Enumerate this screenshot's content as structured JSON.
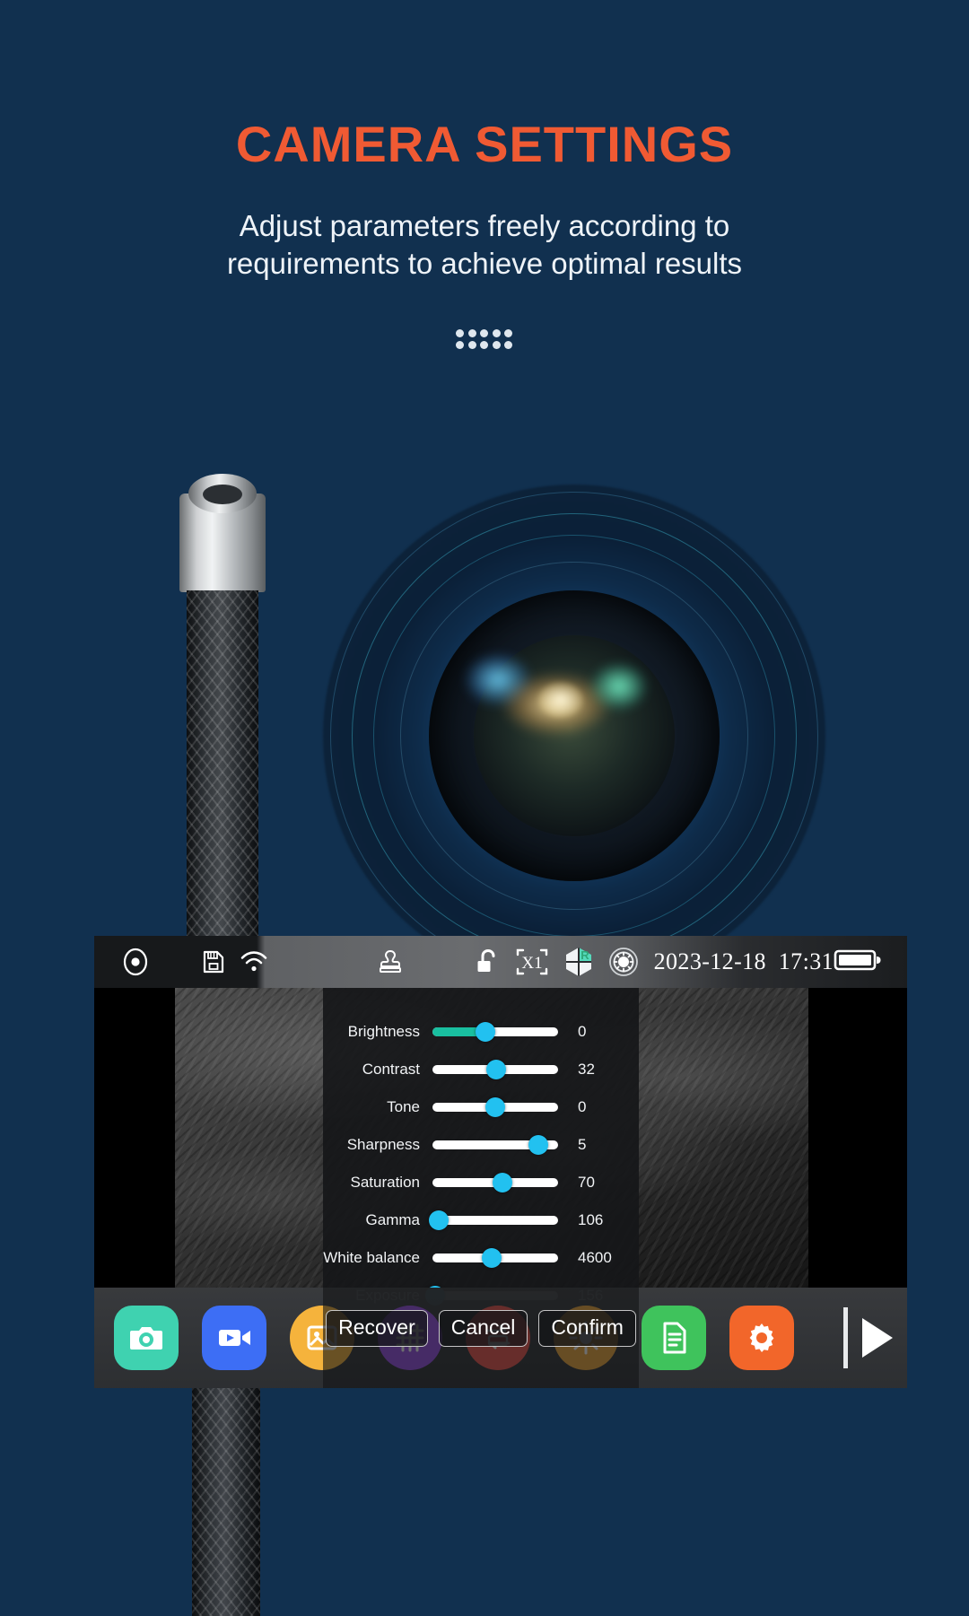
{
  "header": {
    "title": "CAMERA SETTINGS",
    "subtitle_line1": "Adjust parameters freely according to",
    "subtitle_line2": "requirements to achieve optimal results",
    "title_color": "#f05a33",
    "background_color": "#11304f",
    "dots_count": 10
  },
  "device": {
    "statusbar": {
      "record_icon": "record-dot-icon",
      "sd_card_icon": "sd-card-icon",
      "wifi_icon": "wifi-icon",
      "stamp_icon": "stamp-icon",
      "lock_icon": "unlock-padlock-icon",
      "zoom_label": "X1",
      "rotate_icon": "rotate-hexagon-icon",
      "rotate_badge": "R",
      "rotate_badge_color": "#4fe0a8",
      "led_icon": "led-lamp-icon",
      "date": "2023-12-18",
      "time": "17:31",
      "battery_icon": "battery-full-icon"
    },
    "settings_panel": {
      "rows": [
        {
          "label": "Brightness",
          "value": "0",
          "pos": 42,
          "filled": true
        },
        {
          "label": "Contrast",
          "value": "32",
          "pos": 51,
          "filled": false
        },
        {
          "label": "Tone",
          "value": "0",
          "pos": 50,
          "filled": false
        },
        {
          "label": "Sharpness",
          "value": "5",
          "pos": 84,
          "filled": false
        },
        {
          "label": "Saturation",
          "value": "70",
          "pos": 56,
          "filled": false
        },
        {
          "label": "Gamma",
          "value": "106",
          "pos": 5,
          "filled": false
        },
        {
          "label": "White balance",
          "value": "4600",
          "pos": 47,
          "filled": false
        },
        {
          "label": "Exposure",
          "value": "156",
          "pos": 2,
          "filled": false
        }
      ],
      "buttons": {
        "recover": "Recover",
        "cancel": "Cancel",
        "confirm": "Confirm"
      },
      "track_color": "#ffffff",
      "knob_color": "#22c1f0",
      "fill_color": "#19bfa0"
    },
    "toolbar": {
      "items": [
        {
          "name": "photo-capture-button",
          "icon": "camera-icon",
          "color": "#3fd2b0",
          "shape": "rounded"
        },
        {
          "name": "video-record-button",
          "icon": "video-icon",
          "color": "#3d6ef5",
          "shape": "rounded"
        },
        {
          "name": "gallery-button",
          "icon": "image-icon",
          "color": "#f5b33c",
          "shape": "circle"
        },
        {
          "name": "measure-button",
          "icon": "grid-icon",
          "color": "#9a4fe8",
          "shape": "circle"
        },
        {
          "name": "rotate-flip-button",
          "icon": "flip-icon",
          "color": "#f0564c",
          "shape": "circle"
        },
        {
          "name": "light-control-button",
          "icon": "brightness-icon",
          "color": "#f0a93c",
          "shape": "circle"
        },
        {
          "name": "notes-button",
          "icon": "document-icon",
          "color": "#3fc35c",
          "shape": "rounded"
        },
        {
          "name": "settings-button",
          "icon": "gear-icon",
          "color": "#f2662a",
          "shape": "rounded"
        }
      ],
      "next_icon": "next-page-arrow-icon"
    }
  }
}
